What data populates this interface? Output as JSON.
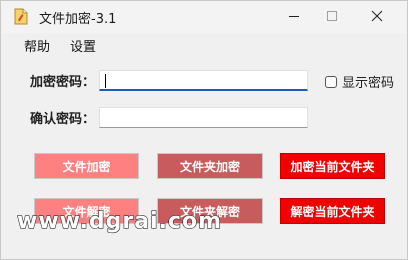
{
  "window": {
    "title": "文件加密-3.1"
  },
  "menu": {
    "items": [
      "帮助",
      "设置"
    ]
  },
  "form": {
    "password_label": "加密密码：",
    "confirm_label": "确认密码：",
    "password_value": "",
    "confirm_value": "",
    "show_password_label": "显示密码",
    "show_password_checked": false
  },
  "buttons": {
    "encrypt_file": "文件加密",
    "encrypt_folder": "文件夹加密",
    "encrypt_current_folder": "加密当前文件夹",
    "decrypt_file": "文件解密",
    "decrypt_folder": "文件夹解密",
    "decrypt_current_folder": "解密当前文件夹"
  },
  "watermark": {
    "text": "www.dgrai.com"
  },
  "colors": {
    "light_red": "#ff8080",
    "muted_red": "#c85c5c",
    "bright_red": "#f00000",
    "focus_blue": "#1a5fb4"
  },
  "icons": {
    "app": "app-file-icon",
    "minimize": "minimize-icon",
    "maximize": "maximize-icon",
    "close": "close-icon"
  }
}
